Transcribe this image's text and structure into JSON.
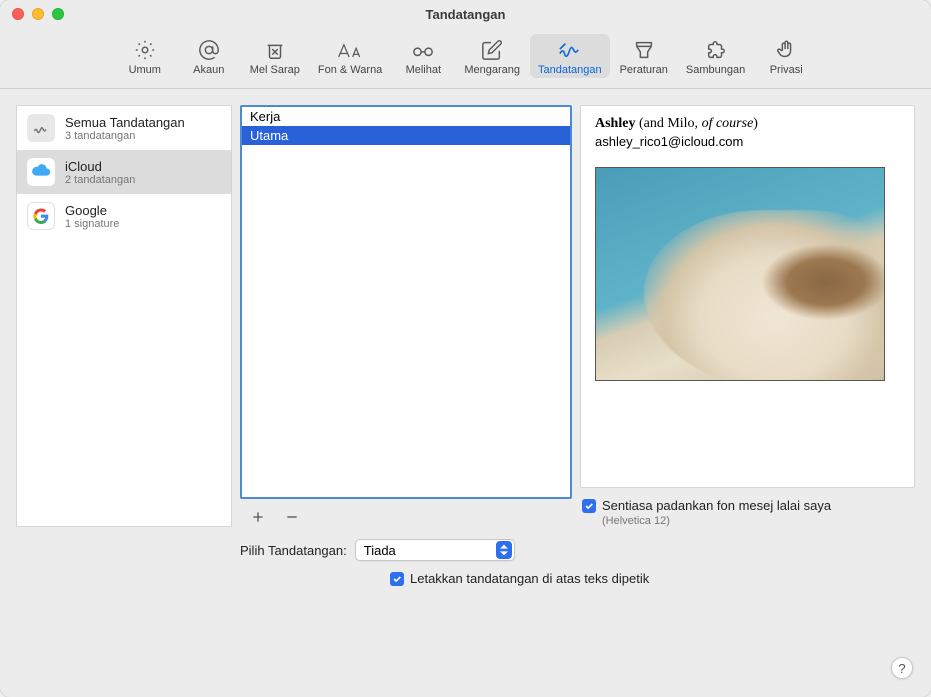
{
  "window": {
    "title": "Tandatangan"
  },
  "toolbar": {
    "items": [
      {
        "label": "Umum"
      },
      {
        "label": "Akaun"
      },
      {
        "label": "Mel Sarap"
      },
      {
        "label": "Fon & Warna"
      },
      {
        "label": "Melihat"
      },
      {
        "label": "Mengarang"
      },
      {
        "label": "Tandatangan"
      },
      {
        "label": "Peraturan"
      },
      {
        "label": "Sambungan"
      },
      {
        "label": "Privasi"
      }
    ]
  },
  "accounts": [
    {
      "name": "Semua Tandatangan",
      "sub": "3 tandatangan"
    },
    {
      "name": "iCloud",
      "sub": "2 tandatangan"
    },
    {
      "name": "Google",
      "sub": "1 signature"
    }
  ],
  "signatures": [
    {
      "name": "Kerja"
    },
    {
      "name": "Utama"
    }
  ],
  "preview": {
    "name_bold": "Ashley",
    "name_rest": " (and Milo, ",
    "name_italic": "of course",
    "name_end": ")",
    "email": "ashley_rico1@icloud.com"
  },
  "match_font": {
    "label": "Sentiasa padankan fon mesej lalai saya",
    "sub": "(Helvetica 12)"
  },
  "choose": {
    "label": "Pilih Tandatangan:",
    "value": "Tiada"
  },
  "place_above": {
    "label": "Letakkan tandatangan di atas teks dipetik"
  }
}
